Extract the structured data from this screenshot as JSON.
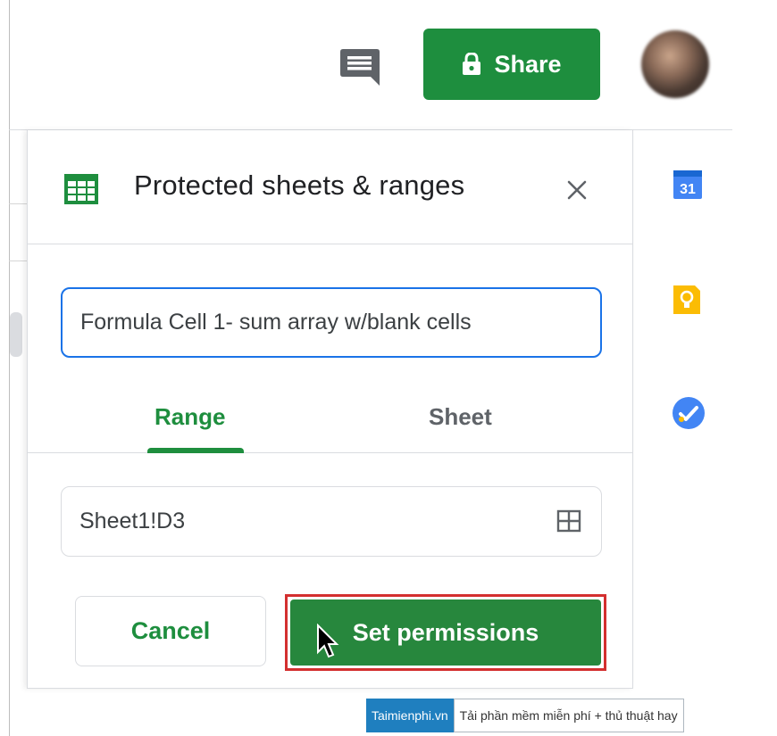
{
  "header": {
    "share_label": "Share",
    "comment_icon": "comment-icon",
    "lock_icon": "lock-icon",
    "avatar": "avatar"
  },
  "panel": {
    "title": "Protected sheets & ranges",
    "description_value": "Formula Cell 1- sum array w/blank cells",
    "tabs": [
      {
        "label": "Range",
        "active": true
      },
      {
        "label": "Sheet",
        "active": false
      }
    ],
    "range_value": "Sheet1!D3",
    "cancel_label": "Cancel",
    "set_permissions_label": "Set permissions"
  },
  "side_panel": {
    "icons": [
      "calendar-icon",
      "keep-icon",
      "tasks-icon"
    ],
    "calendar_day": "31"
  },
  "watermark": {
    "brand": "Taimienphi.vn",
    "tagline": "Tải phần mềm miễn phí + thủ thuật hay"
  },
  "colors": {
    "accent_green": "#1e8e3e",
    "focus_blue": "#1a73e8",
    "highlight_red": "#d32f2f"
  }
}
